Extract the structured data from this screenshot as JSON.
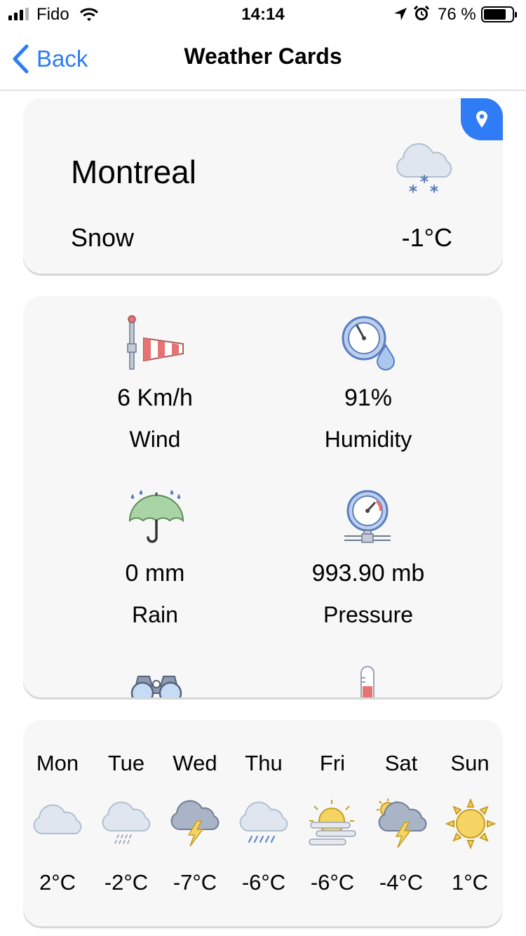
{
  "status_bar": {
    "carrier": "Fido",
    "time": "14:14",
    "battery": "76 %"
  },
  "nav": {
    "back_label": "Back",
    "title": "Weather Cards"
  },
  "current": {
    "city": "Montreal",
    "condition": "Snow",
    "temperature": "-1°C",
    "icon": "snow-cloud-icon"
  },
  "details": [
    {
      "value": "6 Km/h",
      "label": "Wind",
      "icon": "windsock-icon"
    },
    {
      "value": "91%",
      "label": "Humidity",
      "icon": "humidity-gauge-icon"
    },
    {
      "value": "0 mm",
      "label": "Rain",
      "icon": "umbrella-icon"
    },
    {
      "value": "993.90 mb",
      "label": "Pressure",
      "icon": "pressure-gauge-icon"
    }
  ],
  "forecast": [
    {
      "day": "Mon",
      "temp": "2°C",
      "icon": "cloud-icon"
    },
    {
      "day": "Tue",
      "temp": "-2°C",
      "icon": "drizzle-icon"
    },
    {
      "day": "Wed",
      "temp": "-7°C",
      "icon": "thunderstorm-icon"
    },
    {
      "day": "Thu",
      "temp": "-6°C",
      "icon": "rain-icon"
    },
    {
      "day": "Fri",
      "temp": "-6°C",
      "icon": "sun-fog-icon"
    },
    {
      "day": "Sat",
      "temp": "-4°C",
      "icon": "sun-thunder-icon"
    },
    {
      "day": "Sun",
      "temp": "1°C",
      "icon": "sun-icon"
    }
  ],
  "colors": {
    "accent": "#2f7cf6",
    "card_bg": "#f7f7f7"
  }
}
